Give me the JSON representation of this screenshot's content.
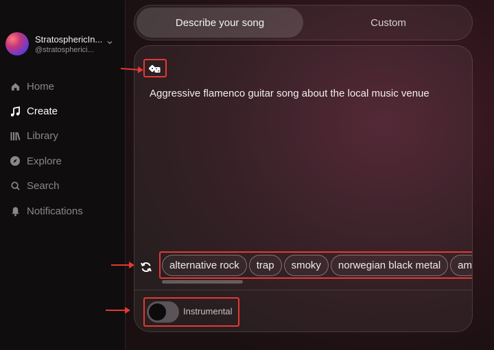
{
  "profile": {
    "name": "StratosphericIn...",
    "handle": "@stratospherici..."
  },
  "nav": [
    {
      "label": "Home",
      "icon": "home-icon",
      "active": false
    },
    {
      "label": "Create",
      "icon": "music-note-icon",
      "active": true
    },
    {
      "label": "Library",
      "icon": "library-icon",
      "active": false
    },
    {
      "label": "Explore",
      "icon": "compass-icon",
      "active": false
    },
    {
      "label": "Search",
      "icon": "search-icon",
      "active": false
    },
    {
      "label": "Notifications",
      "icon": "bell-icon",
      "active": false
    }
  ],
  "tabs": {
    "describe": "Describe your song",
    "custom": "Custom"
  },
  "prompt": {
    "text": "Aggressive flamenco guitar song about the local music venue"
  },
  "tags": [
    "alternative rock",
    "trap",
    "smoky",
    "norwegian black metal",
    "am"
  ],
  "instrumental": {
    "label": "Instrumental",
    "on": false
  },
  "colors": {
    "annotation": "#e53935"
  }
}
